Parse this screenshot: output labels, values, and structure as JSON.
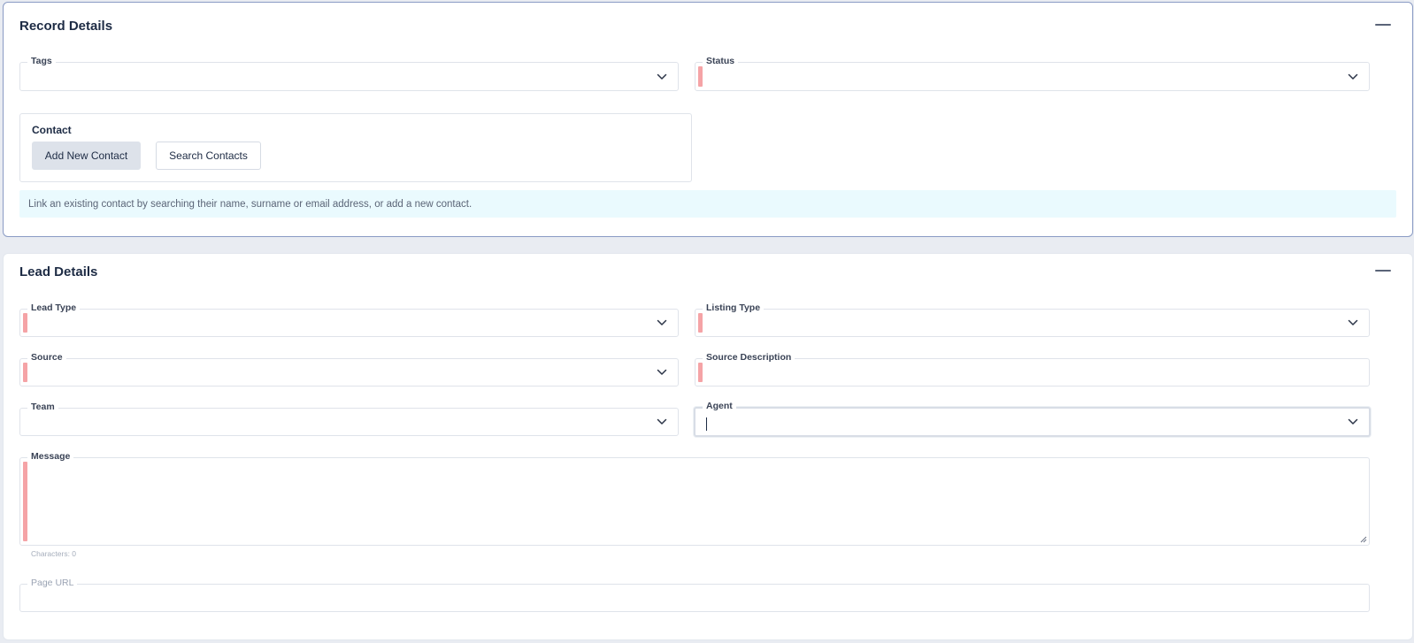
{
  "record_details": {
    "title": "Record Details",
    "tags_label": "Tags",
    "status_label": "Status",
    "contact": {
      "title": "Contact",
      "add_button": "Add New Contact",
      "search_button": "Search Contacts"
    },
    "info_text": "Link an existing contact by searching their name, surname or email address, or add a new contact."
  },
  "lead_details": {
    "title": "Lead Details",
    "lead_type_label": "Lead Type",
    "listing_type_label": "Listing Type",
    "source_label": "Source",
    "source_description_label": "Source Description",
    "team_label": "Team",
    "agent_label": "Agent",
    "message_label": "Message",
    "characters_text": "Characters: 0",
    "page_url_label": "Page URL"
  },
  "icons": {
    "collapse": "minus-icon",
    "dropdown": "chevron-down-icon"
  },
  "colors": {
    "required_marker": "#f5a3a6",
    "info_background": "#eafafe",
    "active_card_border": "#8a9bc4"
  }
}
